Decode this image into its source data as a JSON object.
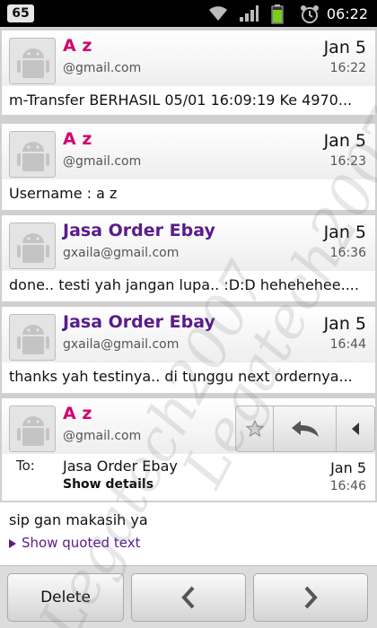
{
  "status_bar": {
    "notification_count": "65",
    "time": "06:22",
    "icons": [
      "wifi-icon",
      "signal-icon",
      "battery-icon",
      "alarm-icon"
    ]
  },
  "messages": [
    {
      "sender": "A z",
      "sender_color": "#d6006e",
      "email": "@gmail.com",
      "date": "Jan 5",
      "time": "16:22",
      "preview": "m-Transfer BERHASIL 05/01 16:09:19 Ke 4970..."
    },
    {
      "sender": "A z",
      "sender_color": "#d6006e",
      "email": "@gmail.com",
      "date": "Jan 5",
      "time": "16:23",
      "preview": "Username : a z"
    },
    {
      "sender": "Jasa Order Ebay",
      "sender_color": "#5a1b8c",
      "email": "gxaila@gmail.com",
      "date": "Jan 5",
      "time": "16:36",
      "preview": "done.. testi yah jangan lupa.. :D:D hehehehee...."
    },
    {
      "sender": "Jasa Order Ebay",
      "sender_color": "#5a1b8c",
      "email": "gxaila@gmail.com",
      "date": "Jan 5",
      "time": "16:44",
      "preview": "thanks yah testinya.. di tunggu next ordernya..."
    }
  ],
  "current": {
    "sender": "A z",
    "email": "@gmail.com",
    "to_label": "To:",
    "to_name": "Jasa Order Ebay",
    "show_details": "Show details",
    "date": "Jan 5",
    "time": "16:46",
    "body": "sip gan makasih ya",
    "show_quoted": "Show quoted text"
  },
  "bottom_bar": {
    "delete_label": "Delete"
  },
  "watermark": "Legatech2007"
}
